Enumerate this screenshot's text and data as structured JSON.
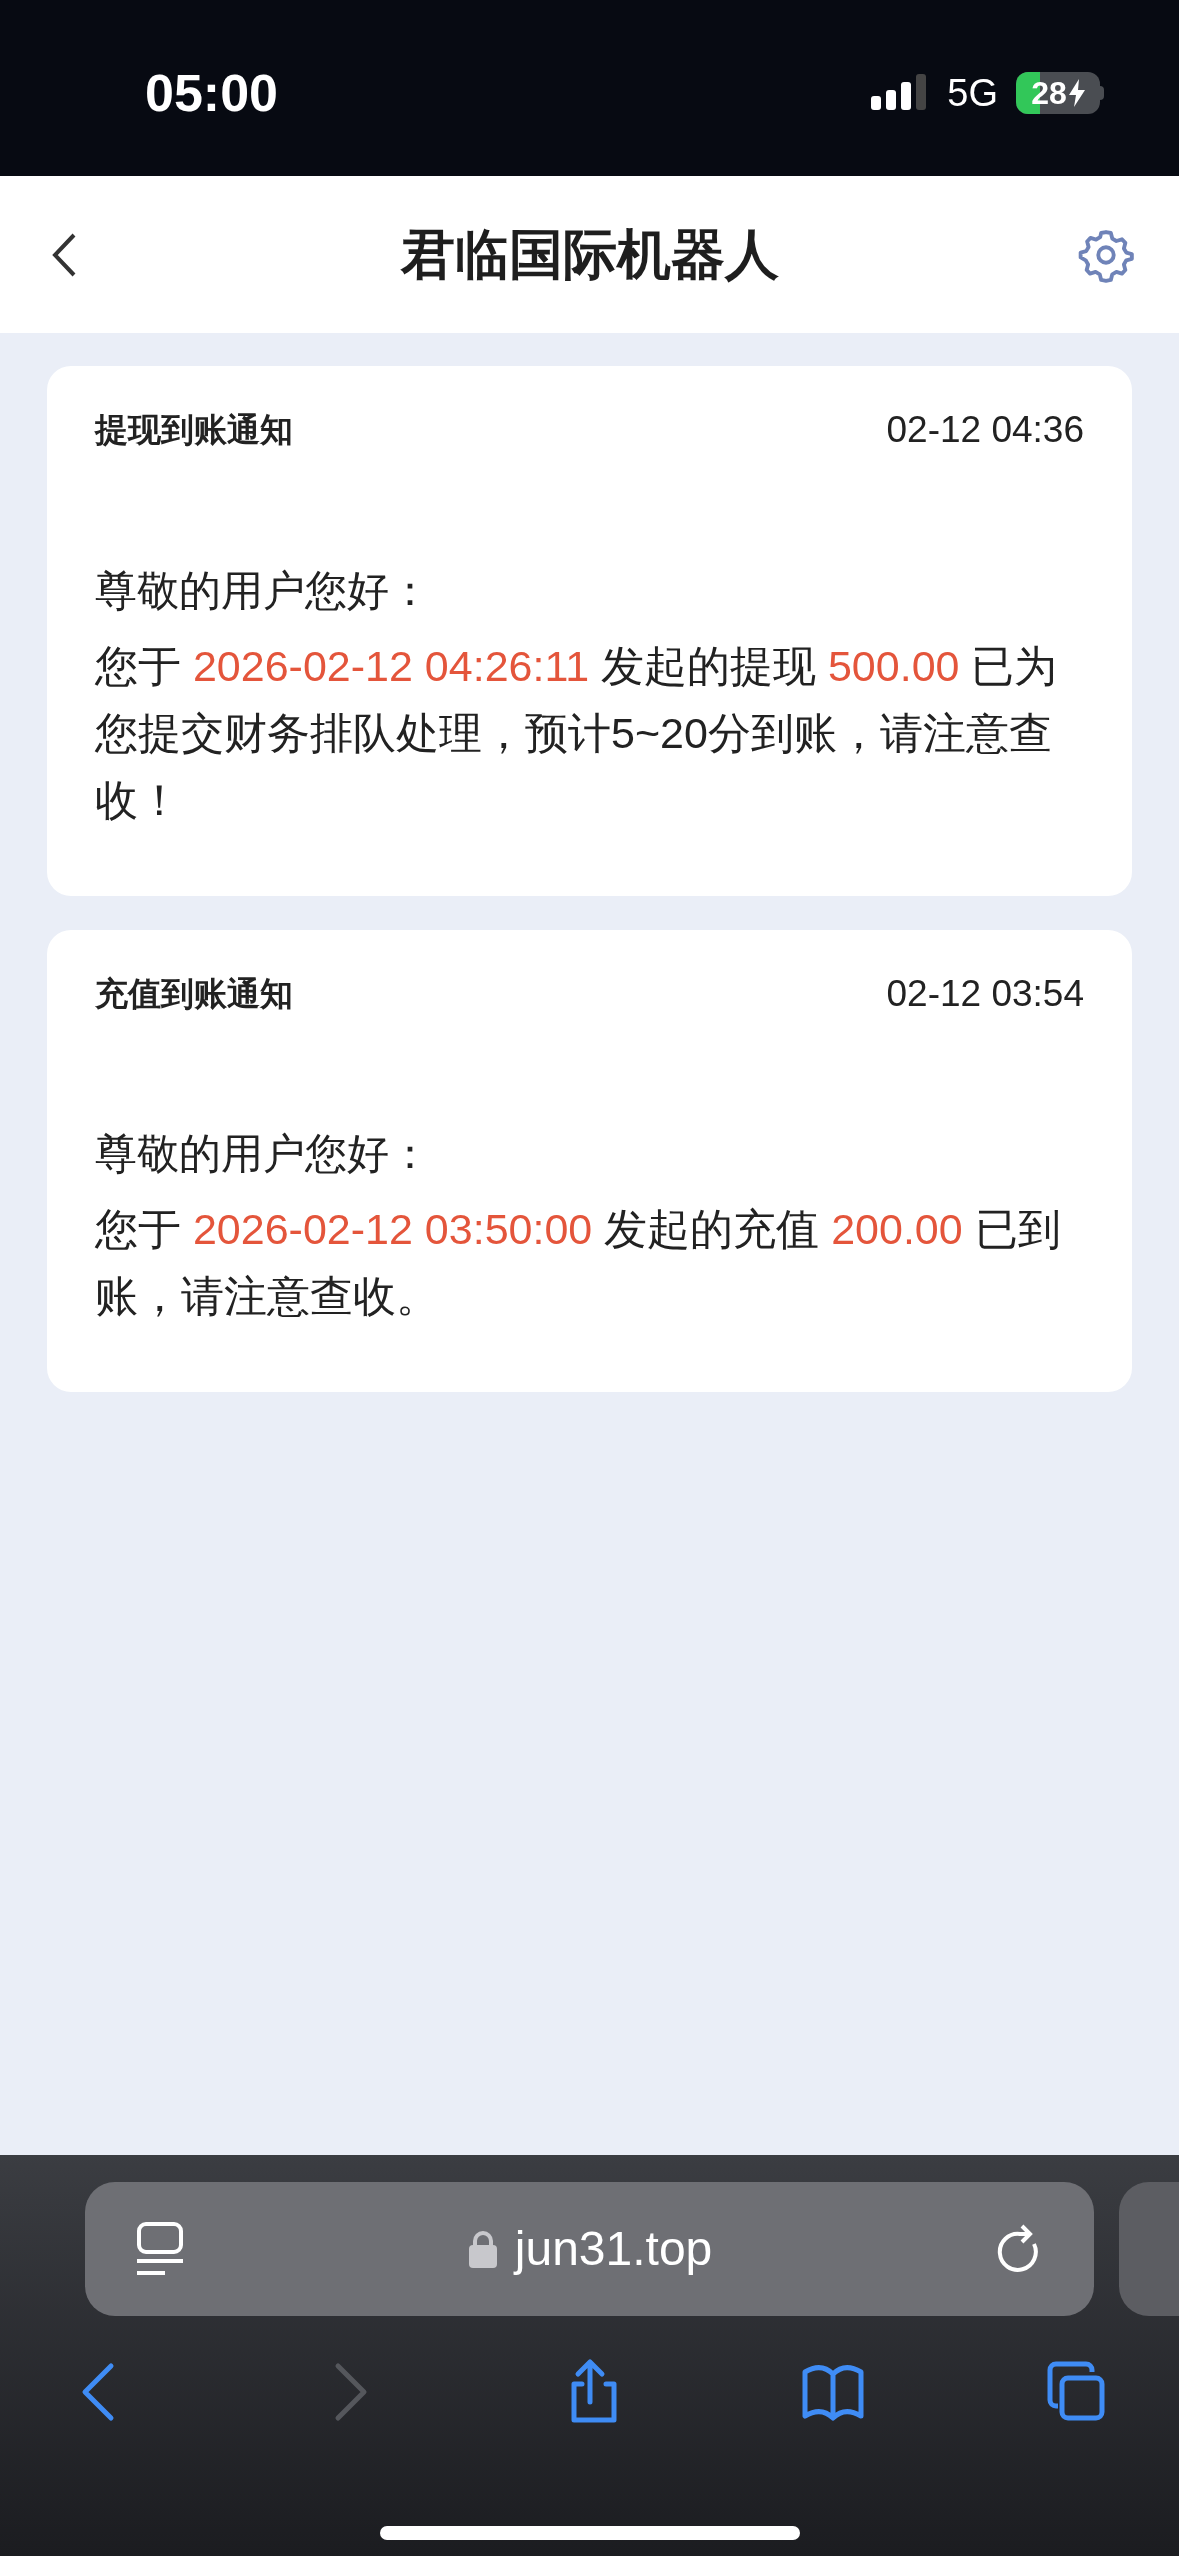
{
  "status_bar": {
    "time": "05:00",
    "network": "5G",
    "battery": "28"
  },
  "header": {
    "title": "君临国际机器人"
  },
  "notifications": [
    {
      "title": "提现到账通知",
      "time": "02-12 04:36",
      "greeting": "尊敬的用户您好：",
      "message": [
        {
          "text": "您于 ",
          "highlight": false
        },
        {
          "text": "2026-02-12 04:26:11",
          "highlight": true
        },
        {
          "text": " 发起的提现 ",
          "highlight": false
        },
        {
          "text": "500.00",
          "highlight": true
        },
        {
          "text": " 已为您提交财务排队处理，预计5~20分到账，请注意查收！",
          "highlight": false
        }
      ]
    },
    {
      "title": "充值到账通知",
      "time": "02-12 03:54",
      "greeting": "尊敬的用户您好：",
      "message": [
        {
          "text": "您于 ",
          "highlight": false
        },
        {
          "text": "2026-02-12 03:50:00",
          "highlight": true
        },
        {
          "text": " 发起的充值 ",
          "highlight": false
        },
        {
          "text": "200.00",
          "highlight": true
        },
        {
          "text": " 已到账，请注意查收。",
          "highlight": false
        }
      ]
    }
  ],
  "browser": {
    "url": "jun31.top",
    "toolbar": [
      {
        "kind": "back",
        "disabled": false
      },
      {
        "kind": "forward",
        "disabled": true
      },
      {
        "kind": "share",
        "disabled": false
      },
      {
        "kind": "bookmarks",
        "disabled": false
      },
      {
        "kind": "tabs",
        "disabled": false
      }
    ]
  }
}
